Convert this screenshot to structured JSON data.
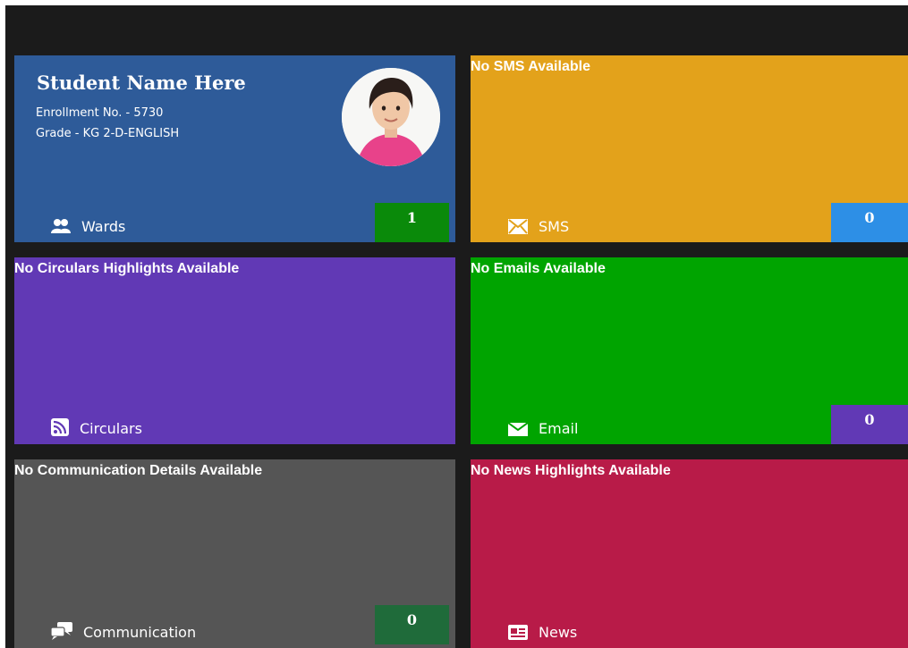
{
  "student": {
    "name": "Student Name Here",
    "enrollment": "Enrollment No. - 5730",
    "grade": "Grade - KG 2-D-ENGLISH",
    "wards_label": "Wards",
    "wards_count": "1",
    "badge_color": "#0a8a0a"
  },
  "sms": {
    "message": "No SMS Available",
    "label": "SMS",
    "count": "0",
    "badge_color": "#2d8fe6"
  },
  "circulars": {
    "message": "No Circulars Highlights Available",
    "label": "Circulars"
  },
  "email": {
    "message": "No Emails Available",
    "label": "Email",
    "count": "0",
    "badge_color": "#6139b5"
  },
  "communication": {
    "message": "No Communication Details Available",
    "label": "Communication",
    "count": "0",
    "badge_color": "#1f6b3a"
  },
  "news": {
    "message": "No News Highlights Available",
    "label": "News"
  },
  "icons": [
    "users-icon",
    "envelope-icon",
    "rss-icon",
    "mail-icon",
    "chat-icon",
    "newspaper-icon"
  ],
  "colors": {
    "student_tile": "#2e5b99",
    "sms_tile": "#e3a21b",
    "circulars_tile": "#6139b5",
    "email_tile": "#00a400",
    "communication_tile": "#555555",
    "news_tile": "#b81b48"
  }
}
